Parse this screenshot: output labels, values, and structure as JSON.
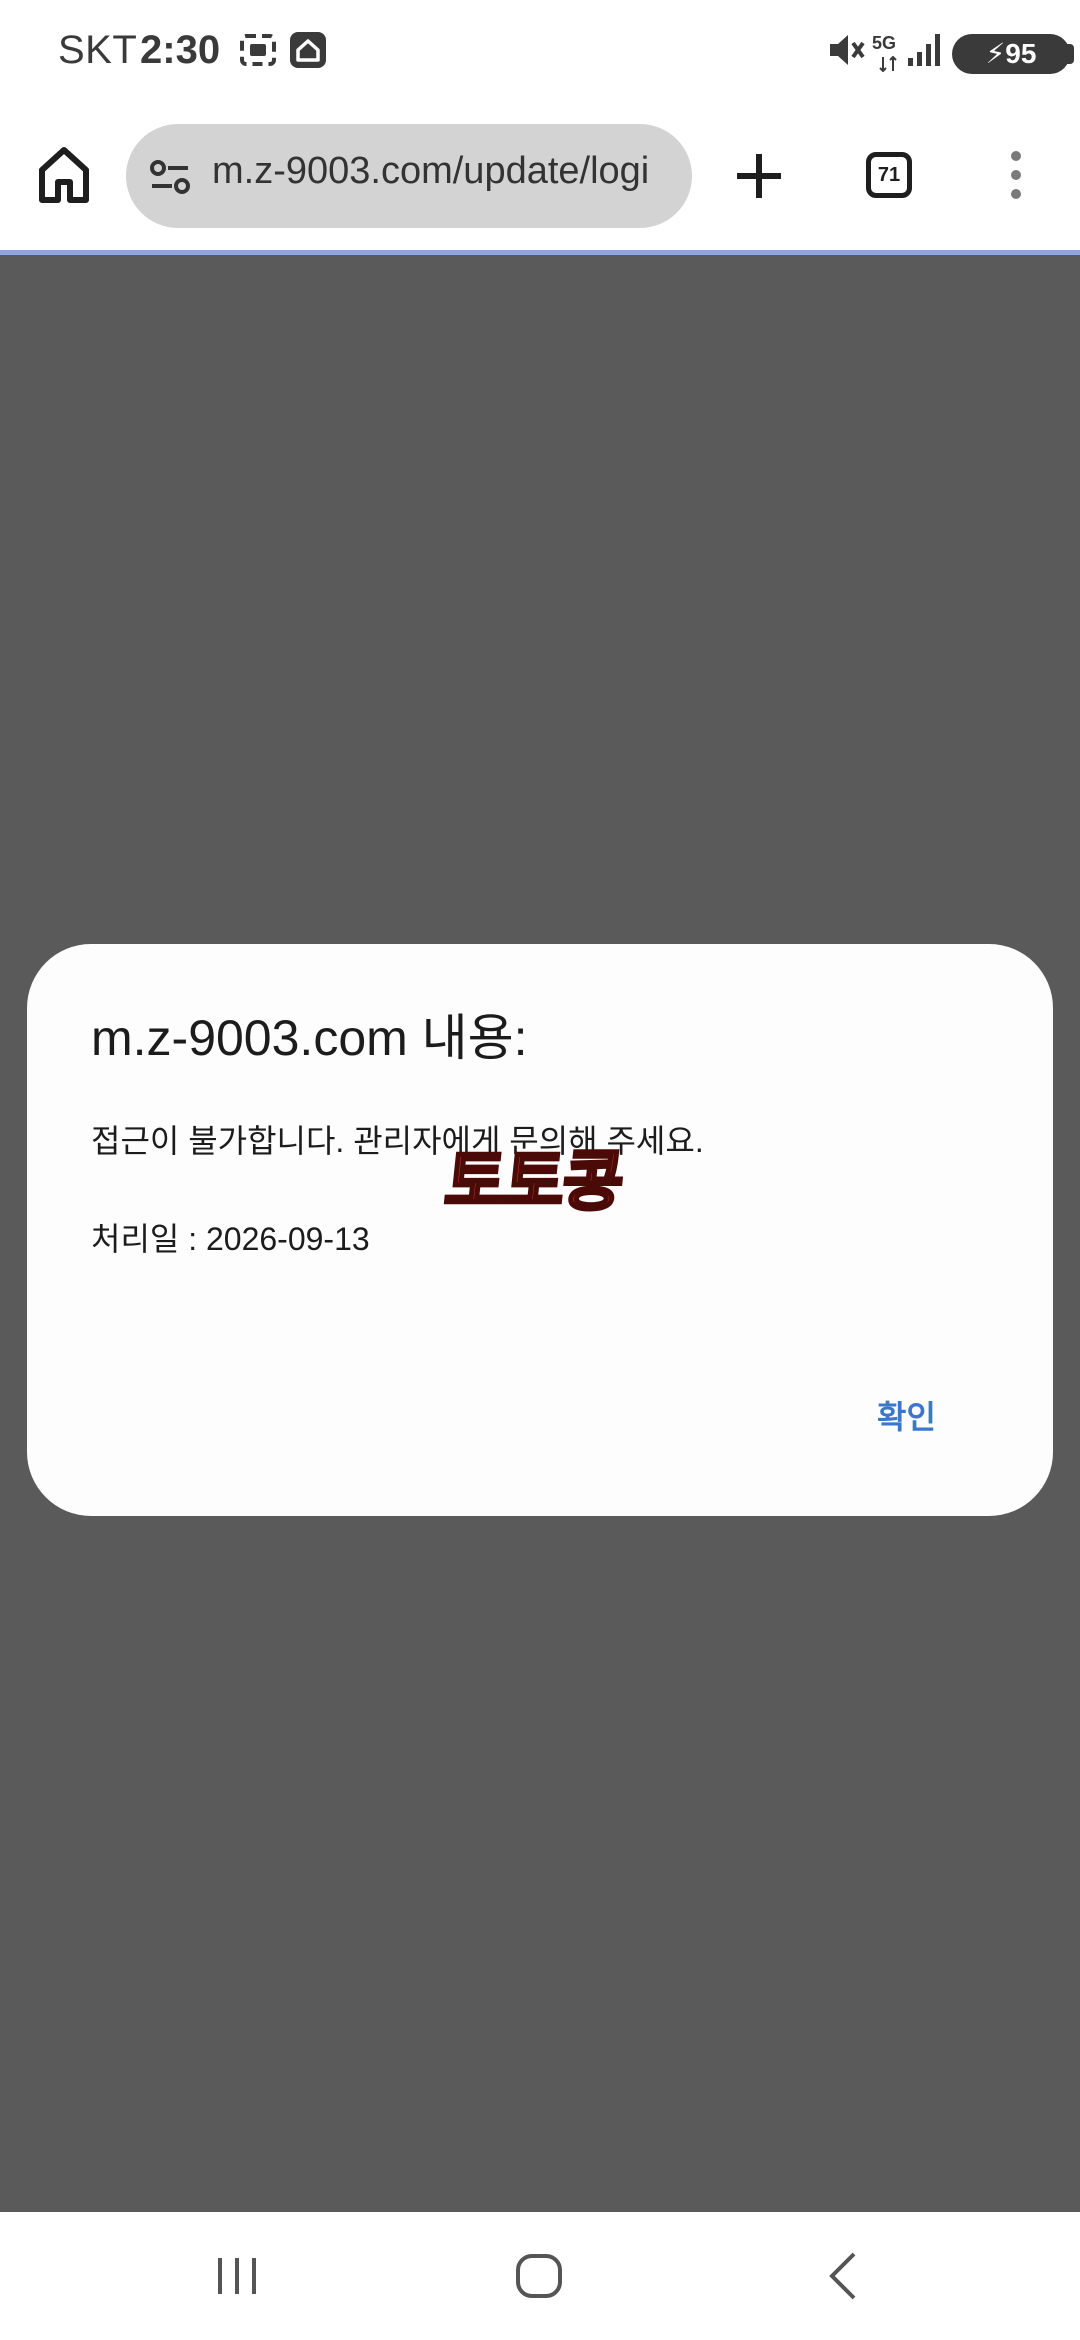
{
  "status_bar": {
    "carrier": "SKT",
    "time": "2:30",
    "network": "5G",
    "battery": "95"
  },
  "browser": {
    "url": "m.z-9003.com/update/logi",
    "tab_count": "71"
  },
  "dialog": {
    "title": "m.z-9003.com 내용:",
    "message": "접근이 불가합니다. 관리자에게 문의해 주세요.",
    "date_line": "처리일 : 2026-09-13",
    "confirm_label": "확인"
  },
  "watermark": {
    "text": "토토콩"
  },
  "colors": {
    "scrim": "#5a5a5a",
    "accent": "#3b78c9",
    "watermark": "#e0322c"
  }
}
